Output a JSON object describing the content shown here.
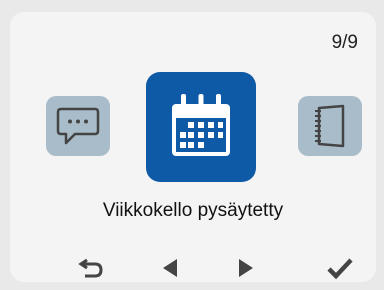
{
  "header": {
    "page_counter": "9/9"
  },
  "carousel": {
    "items": [
      {
        "icon": "chat-bubble-icon"
      },
      {
        "icon": "calendar-icon",
        "selected": true
      },
      {
        "icon": "notebook-icon"
      }
    ],
    "caption": "Viikkokello pysäytetty"
  },
  "nav": {
    "buttons": [
      "back-icon",
      "arrow-left-icon",
      "arrow-right-icon",
      "checkmark-icon"
    ]
  },
  "colors": {
    "selected_tile": "#0f5aa6",
    "inactive_tile": "#a9bcc9",
    "icon_dark": "#444444"
  }
}
